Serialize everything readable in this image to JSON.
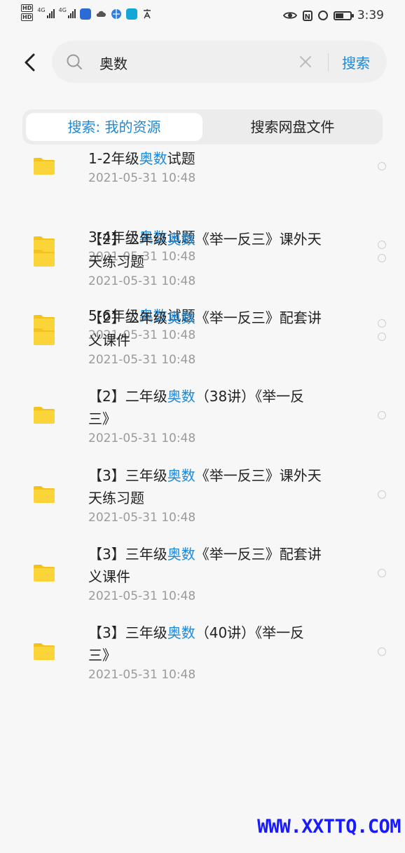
{
  "status_bar": {
    "hd_labels": [
      "HD",
      "HD"
    ],
    "signal_labels": [
      "4G",
      "4G"
    ],
    "time": "3:39",
    "battery_level": 0.55
  },
  "search": {
    "query": "奥数",
    "button_label": "搜索"
  },
  "tabs": [
    {
      "label": "搜索: 我的资源",
      "active": true
    },
    {
      "label": "搜索网盘文件",
      "active": false
    }
  ],
  "results": [
    {
      "line1": [
        {
          "t": "1-2年级"
        },
        {
          "t": "奥数",
          "hl": true
        },
        {
          "t": "试题"
        }
      ],
      "line2": [],
      "date": "2021-05-31 10:48"
    },
    {
      "line1": [
        {
          "t": "3-4年级"
        },
        {
          "t": "奥数",
          "hl": true
        },
        {
          "t": "试题"
        }
      ],
      "line2": [],
      "date": "2021-05-31 10:48"
    },
    {
      "line1": [
        {
          "t": "5-6年级"
        },
        {
          "t": "奥数",
          "hl": true
        },
        {
          "t": "试题"
        }
      ],
      "line2": [],
      "date": "2021-05-31 10:48"
    },
    {
      "line1": [
        {
          "t": "【2】二年级"
        },
        {
          "t": "奥数",
          "hl": true
        },
        {
          "t": "《举一反三》课外天"
        }
      ],
      "line2": [
        {
          "t": "天练习题"
        }
      ],
      "date": "2021-05-31 10:48"
    },
    {
      "line1": [
        {
          "t": "【2】二年级"
        },
        {
          "t": "奥数",
          "hl": true
        },
        {
          "t": "《举一反三》配套讲"
        }
      ],
      "line2": [
        {
          "t": "义课件"
        }
      ],
      "date": "2021-05-31 10:48"
    },
    {
      "line1": [
        {
          "t": "【2】二年级"
        },
        {
          "t": "奥数",
          "hl": true
        },
        {
          "t": "（38讲）《举一反"
        }
      ],
      "line2": [
        {
          "t": "三》"
        }
      ],
      "date": "2021-05-31 10:48"
    },
    {
      "line1": [
        {
          "t": "【3】三年级"
        },
        {
          "t": "奥数",
          "hl": true
        },
        {
          "t": "《举一反三》课外天"
        }
      ],
      "line2": [
        {
          "t": "天练习题"
        }
      ],
      "date": "2021-05-31 10:48"
    },
    {
      "line1": [
        {
          "t": "【3】三年级"
        },
        {
          "t": "奥数",
          "hl": true
        },
        {
          "t": "《举一反三》配套讲"
        }
      ],
      "line2": [
        {
          "t": "义课件"
        }
      ],
      "date": "2021-05-31 10:48"
    },
    {
      "line1": [
        {
          "t": "【3】三年级"
        },
        {
          "t": "奥数",
          "hl": true
        },
        {
          "t": "（40讲）《举一反"
        }
      ],
      "line2": [
        {
          "t": "三》"
        }
      ],
      "date": "2021-05-31 10:48"
    }
  ],
  "watermark": "WWW.XXTTQ.COM",
  "colors": {
    "accent": "#1e88d6",
    "folder": "#fbd43a",
    "folder_tab": "#f3c21f"
  }
}
